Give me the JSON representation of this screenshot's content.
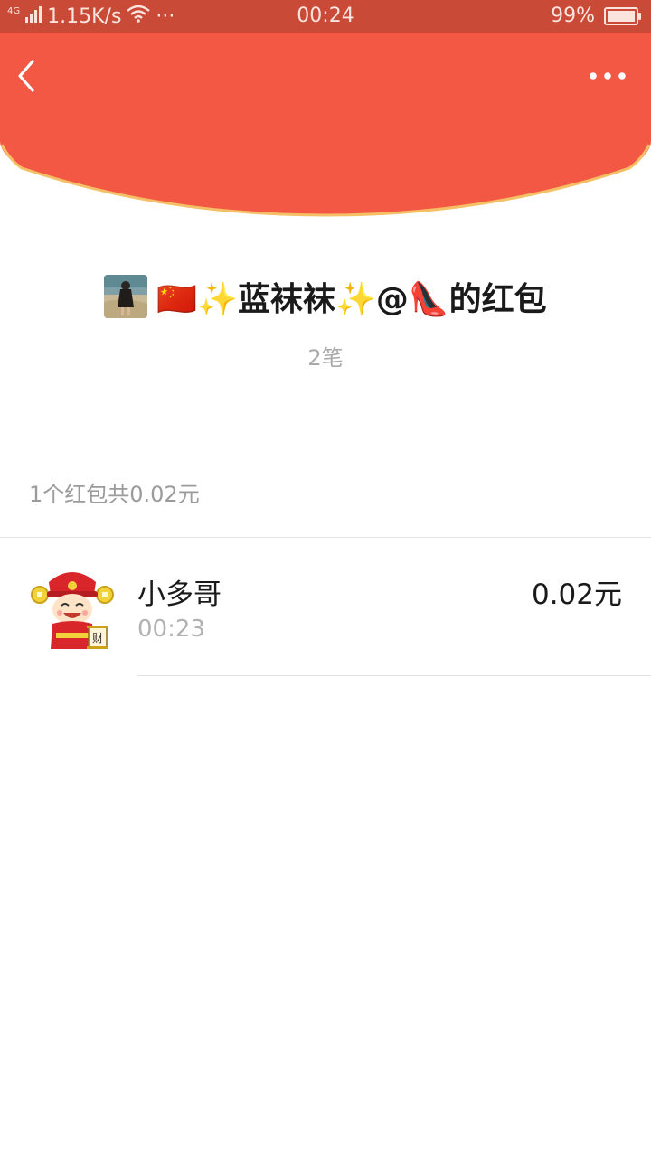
{
  "status_bar": {
    "network_type": "4G",
    "speed": "1.15K/s",
    "more_dots": "···",
    "time": "00:24",
    "battery": "99%",
    "background_color": "#c84a37"
  },
  "header": {
    "background_color": "#f35844",
    "rim_color": "#f5c065",
    "back_icon": "chevron-left-icon",
    "more_icon": "ellipsis-icon"
  },
  "packet": {
    "sender_title": "🇨🇳✨蓝袜袜✨@👠的红包",
    "count": "2笔"
  },
  "summary": "1个红包共0.02元",
  "recipients": [
    {
      "name": "小多哥",
      "time": "00:23",
      "amount": "0.02元"
    }
  ]
}
